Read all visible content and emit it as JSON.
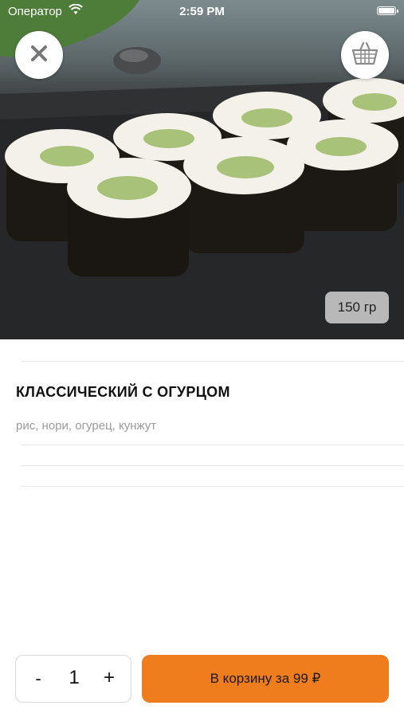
{
  "status_bar": {
    "carrier": "Оператор",
    "time": "2:59 PM"
  },
  "product": {
    "weight": "150 гр",
    "name": "КЛАССИЧЕСКИЙ С ОГУРЦОМ",
    "ingredients": "рис, нори, огурец, кунжут"
  },
  "order": {
    "quantity": "1",
    "minus_label": "-",
    "plus_label": "+",
    "add_to_cart_label": "В корзину за 99 ₽"
  },
  "icons": {
    "close": "close-icon",
    "cart": "basket-icon"
  },
  "colors": {
    "accent": "#ef7d1e"
  }
}
